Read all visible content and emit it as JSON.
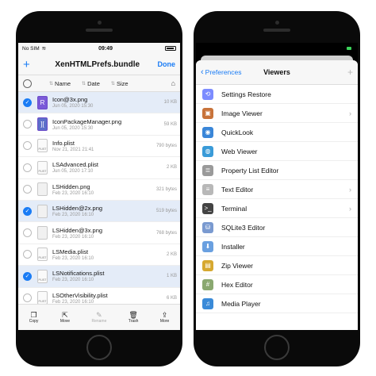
{
  "left": {
    "status": {
      "carrier": "No SIM",
      "time": "09:49"
    },
    "nav": {
      "add": "+",
      "title": "XenHTMLPrefs.bundle",
      "done": "Done"
    },
    "sort": {
      "name": "Name",
      "date": "Date",
      "size": "Size"
    },
    "files": [
      {
        "name": "Icon@3x.png",
        "date": "Jun 05, 2020 15:30",
        "size": "10 KB",
        "selected": true,
        "icon": "app-icon"
      },
      {
        "name": "IconPackageManager.png",
        "date": "Jun 05, 2020 15:30",
        "size": "59 KB",
        "selected": false,
        "icon": "app-icon-big"
      },
      {
        "name": "Info.plist",
        "date": "Nov 21, 2021 21:41",
        "size": "790 bytes",
        "selected": false,
        "icon": "plist-icon"
      },
      {
        "name": "LSAdvanced.plist",
        "date": "Jun 05, 2020 17:10",
        "size": "2 KB",
        "selected": false,
        "icon": "plist-icon"
      },
      {
        "name": "LSHidden.png",
        "date": "Feb 23, 2020 16:10",
        "size": "321 bytes",
        "selected": false,
        "icon": "png-icon"
      },
      {
        "name": "LSHidden@2x.png",
        "date": "Feb 23, 2020 16:10",
        "size": "519 bytes",
        "selected": true,
        "icon": "png-icon"
      },
      {
        "name": "LSHidden@3x.png",
        "date": "Feb 23, 2020 16:10",
        "size": "768 bytes",
        "selected": false,
        "icon": "png-icon"
      },
      {
        "name": "LSMedia.plist",
        "date": "Feb 23, 2020 16:10",
        "size": "2 KB",
        "selected": false,
        "icon": "plist-icon"
      },
      {
        "name": "LSNotifications.plist",
        "date": "Feb 23, 2020 16:10",
        "size": "1 KB",
        "selected": true,
        "icon": "plist-icon"
      },
      {
        "name": "LSOtherVisibility.plist",
        "date": "Feb 23, 2020 16:10",
        "size": "6 KB",
        "selected": false,
        "icon": "plist-icon"
      }
    ],
    "toolbar": {
      "copy": "Copy",
      "move": "Move",
      "rename": "Rename",
      "trash": "Trash",
      "more": "More"
    }
  },
  "right": {
    "nav": {
      "back": "Preferences",
      "title": "Viewers",
      "plus": "+"
    },
    "viewers": [
      {
        "label": "Settings Restore",
        "icon": "settings-restore-icon",
        "color": "#7c8cff",
        "chevron": false
      },
      {
        "label": "Image Viewer",
        "icon": "image-viewer-icon",
        "color": "#c8733a",
        "chevron": true
      },
      {
        "label": "QuickLook",
        "icon": "quicklook-icon",
        "color": "#3a86d8",
        "chevron": false
      },
      {
        "label": "Web Viewer",
        "icon": "web-viewer-icon",
        "color": "#3a9bd8",
        "chevron": false
      },
      {
        "label": "Property List Editor",
        "icon": "property-list-icon",
        "color": "#9a9a9a",
        "chevron": false
      },
      {
        "label": "Text Editor",
        "icon": "text-editor-icon",
        "color": "#b8b8b8",
        "chevron": true
      },
      {
        "label": "Terminal",
        "icon": "terminal-icon",
        "color": "#444444",
        "chevron": true
      },
      {
        "label": "SQLite3 Editor",
        "icon": "sqlite-icon",
        "color": "#7a9ad0",
        "chevron": false
      },
      {
        "label": "Installer",
        "icon": "installer-icon",
        "color": "#6aa0e0",
        "chevron": false
      },
      {
        "label": "Zip Viewer",
        "icon": "zip-viewer-icon",
        "color": "#d6a830",
        "chevron": false
      },
      {
        "label": "Hex Editor",
        "icon": "hex-editor-icon",
        "color": "#8aa870",
        "chevron": false
      },
      {
        "label": "Media Player",
        "icon": "media-player-icon",
        "color": "#3a8ad8",
        "chevron": false
      }
    ]
  }
}
